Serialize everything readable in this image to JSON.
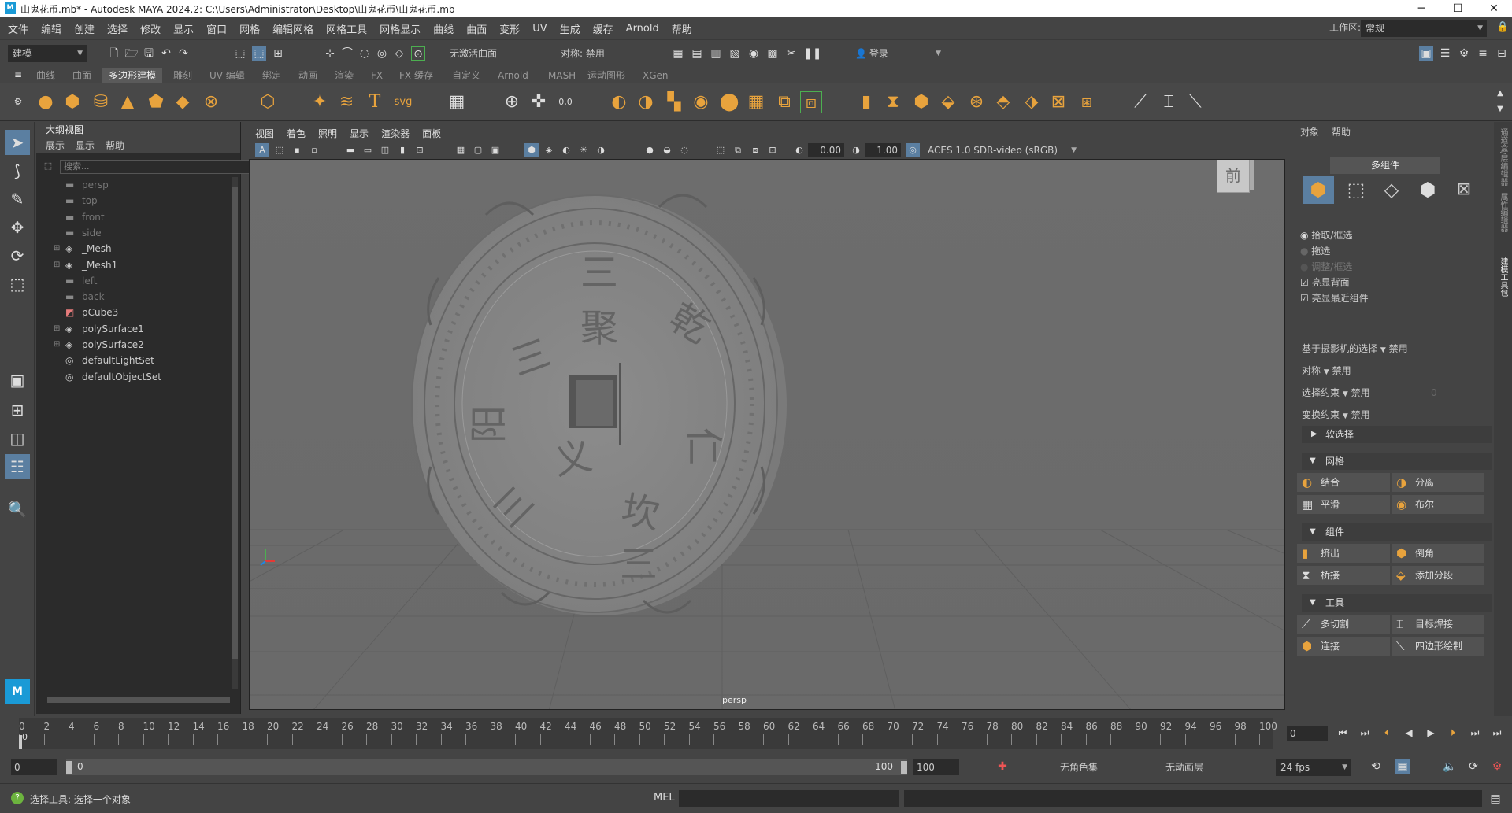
{
  "window": {
    "title": "山鬼花币.mb* - Autodesk MAYA 2024.2: C:\\Users\\Administrator\\Desktop\\山鬼花币\\山鬼花币.mb",
    "min": "─",
    "max": "☐",
    "close": "✕"
  },
  "menubar": [
    "文件",
    "编辑",
    "创建",
    "选择",
    "修改",
    "显示",
    "窗口",
    "网格",
    "编辑网格",
    "网格工具",
    "网格显示",
    "曲线",
    "曲面",
    "变形",
    "UV",
    "生成",
    "缓存",
    "Arnold",
    "帮助"
  ],
  "workspace": {
    "label": "工作区:",
    "value": "常规"
  },
  "status": {
    "mode": "建模",
    "live_surface": "无激活曲面",
    "symmetry": "对称: 禁用",
    "login": "登录"
  },
  "shelf_tabs": [
    "曲线",
    "曲面",
    "多边形建模",
    "雕刻",
    "UV 编辑",
    "绑定",
    "动画",
    "渲染",
    "FX",
    "FX 缓存",
    "自定义",
    "Arnold",
    "MASH",
    "运动图形",
    "XGen"
  ],
  "shelf_active": "多边形建模",
  "outliner": {
    "title": "大纲视图",
    "menu": [
      "展示",
      "显示",
      "帮助"
    ],
    "search_placeholder": "搜索...",
    "items": [
      {
        "label": "persp",
        "dim": true,
        "expand": "",
        "icon": "cam"
      },
      {
        "label": "top",
        "dim": true,
        "expand": "",
        "icon": "cam"
      },
      {
        "label": "front",
        "dim": true,
        "expand": "",
        "icon": "cam"
      },
      {
        "label": "side",
        "dim": true,
        "expand": "",
        "icon": "cam"
      },
      {
        "label": "_Mesh",
        "dim": false,
        "expand": "⊞",
        "icon": "mesh"
      },
      {
        "label": "_Mesh1",
        "dim": false,
        "expand": "⊞",
        "icon": "mesh"
      },
      {
        "label": "left",
        "dim": true,
        "expand": "",
        "icon": "cam"
      },
      {
        "label": "back",
        "dim": true,
        "expand": "",
        "icon": "cam"
      },
      {
        "label": "pCube3",
        "dim": false,
        "expand": "",
        "icon": "cube"
      },
      {
        "label": "polySurface1",
        "dim": false,
        "expand": "⊞",
        "icon": "mesh"
      },
      {
        "label": "polySurface2",
        "dim": false,
        "expand": "⊞",
        "icon": "mesh"
      },
      {
        "label": "defaultLightSet",
        "dim": false,
        "expand": "",
        "icon": "set"
      },
      {
        "label": "defaultObjectSet",
        "dim": false,
        "expand": "",
        "icon": "set"
      }
    ]
  },
  "viewport": {
    "menu": [
      "视图",
      "着色",
      "照明",
      "显示",
      "渲染器",
      "面板"
    ],
    "exposure": "0.00",
    "gamma": "1.00",
    "colorspace": "ACES 1.0 SDR-video (sRGB)",
    "camera_label": "persp",
    "viewcube": "前",
    "coin_chars": [
      "三",
      "聚",
      "三",
      "阳",
      "义",
      "三",
      "乾",
      "仁",
      "坎",
      "三"
    ]
  },
  "rightpanel": {
    "menu": [
      "对象",
      "帮助"
    ],
    "mode_title": "多组件",
    "options": [
      "拾取/框选",
      "拖选",
      "调整/框选",
      "亮显背面",
      "亮显最近组件"
    ],
    "cam_sel": {
      "label": "基于摄影机的选择",
      "value": "禁用"
    },
    "symmetry": {
      "label": "对称",
      "value": "禁用"
    },
    "sel_constraint": {
      "label": "选择约束",
      "value": "禁用",
      "num": "0"
    },
    "transform_constraint": {
      "label": "变换约束",
      "value": "禁用"
    },
    "soft_select": "软选择",
    "sections": {
      "mesh": {
        "title": "网格",
        "buttons": [
          "结合",
          "分离",
          "平滑",
          "布尔"
        ]
      },
      "components": {
        "title": "组件",
        "buttons": [
          "挤出",
          "倒角",
          "桥接",
          "添加分段"
        ]
      },
      "tools": {
        "title": "工具",
        "buttons": [
          "多切割",
          "目标焊接",
          "连接",
          "四边形绘制"
        ]
      }
    }
  },
  "sidetabs": [
    "通道盒/层编辑器",
    "属性编辑器",
    "建模工具包"
  ],
  "timeline": {
    "ticks": [
      "0",
      "2",
      "4",
      "6",
      "8",
      "10",
      "12",
      "14",
      "16",
      "18",
      "20",
      "22",
      "24",
      "26",
      "28",
      "30",
      "32",
      "34",
      "36",
      "38",
      "40",
      "42",
      "44",
      "46",
      "48",
      "50",
      "52",
      "54",
      "56",
      "58",
      "60",
      "62",
      "64",
      "66",
      "68",
      "70",
      "72",
      "74",
      "76",
      "78",
      "80",
      "82",
      "84",
      "86",
      "88",
      "90",
      "92",
      "94",
      "96",
      "98",
      "100"
    ],
    "current_frame": "0",
    "cursor_frame": "0"
  },
  "range": {
    "start": "0",
    "inner_start": "0",
    "inner_end": "100",
    "end": "100",
    "char_set": "无角色集",
    "anim_layer": "无动画层",
    "fps": "24 fps"
  },
  "cmdline": {
    "help": "选择工具: 选择一个对象",
    "lang": "MEL"
  },
  "colors": {
    "bg": "#444444",
    "panel_dark": "#2b2b2b",
    "accent": "#5b7fa1",
    "icon_orange": "#e8a33d"
  }
}
